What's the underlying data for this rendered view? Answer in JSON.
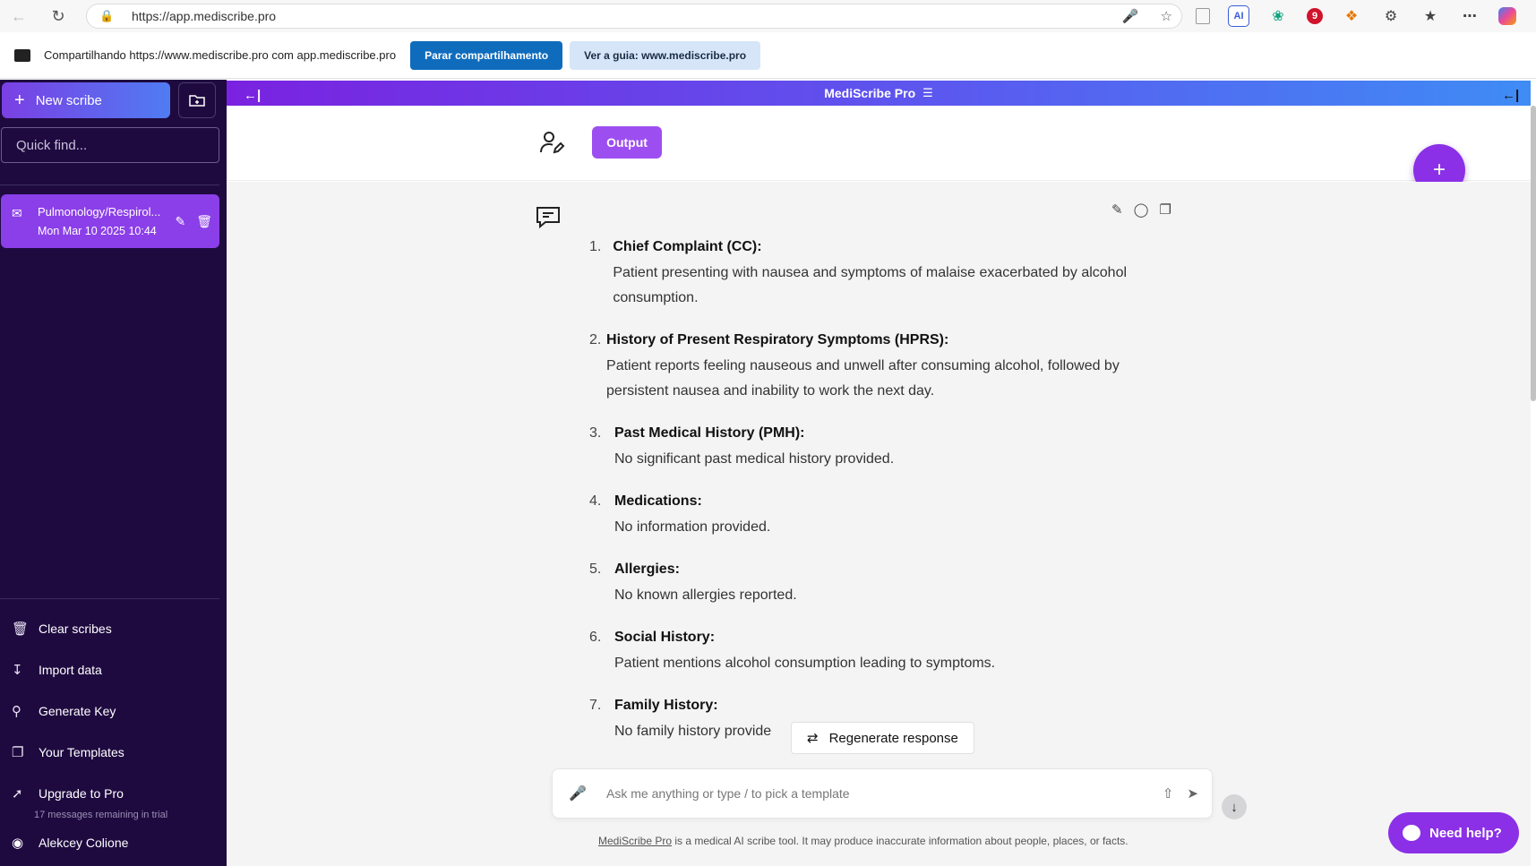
{
  "browser": {
    "url": "https://app.mediscribe.pro",
    "back_icon": "arrow-left-icon",
    "refresh_icon": "refresh-icon"
  },
  "share_bar": {
    "text": "Compartilhando https://www.mediscribe.pro com app.mediscribe.pro",
    "stop_label": "Parar compartilhamento",
    "view_label": "Ver a guia: www.mediscribe.pro"
  },
  "sidebar": {
    "new_scribe_label": "New scribe",
    "search_placeholder": "Quick find...",
    "chats": [
      {
        "title": "Pulmonology/Respirol...",
        "date": "Mon Mar 10 2025 10:44"
      }
    ],
    "menu": [
      {
        "label": "Clear scribes",
        "icon": "trash-icon"
      },
      {
        "label": "Import data",
        "icon": "download-icon"
      },
      {
        "label": "Generate Key",
        "icon": "key-icon"
      },
      {
        "label": "Your Templates",
        "icon": "templates-icon"
      },
      {
        "label": "Upgrade to Pro",
        "icon": "rocket-icon"
      }
    ],
    "trial_note": "17 messages remaining in trial",
    "user_name": "Alekcey Colione"
  },
  "header": {
    "title": "MediScribe Pro"
  },
  "toolbar": {
    "output_label": "Output"
  },
  "note": {
    "items": [
      {
        "num": "1.",
        "heading": "Chief Complaint (CC):",
        "body": "Patient presenting with nausea and symptoms of malaise exacerbated by alcohol consumption."
      },
      {
        "num": "2.",
        "heading": "History of Present Respiratory Symptoms (HPRS):",
        "body": "Patient reports feeling nauseous and unwell after consuming alcohol, followed by persistent nausea and inability to work the next day."
      },
      {
        "num": "3.",
        "heading": "Past Medical History (PMH):",
        "body": "No significant past medical history provided."
      },
      {
        "num": "4.",
        "heading": "Medications:",
        "body": "No information provided."
      },
      {
        "num": "5.",
        "heading": "Allergies:",
        "body": "No known allergies reported."
      },
      {
        "num": "6.",
        "heading": "Social History:",
        "body": "Patient mentions alcohol consumption leading to symptoms."
      },
      {
        "num": "7.",
        "heading": "Family History:",
        "body": "No family history provide"
      }
    ]
  },
  "regenerate_label": "Regenerate response",
  "prompt": {
    "placeholder": "Ask me anything or type / to pick a template"
  },
  "disclaimer": {
    "brand": "MediScribe Pro",
    "text": " is a medical AI scribe tool. It may produce inaccurate information about people, places, or facts."
  },
  "help_label": "Need help?",
  "colors": {
    "sidebar_bg": "#1f0a40",
    "accent": "#8b30e6",
    "header_gradient_start": "#7a22e0",
    "header_gradient_end": "#3f8cf5"
  }
}
